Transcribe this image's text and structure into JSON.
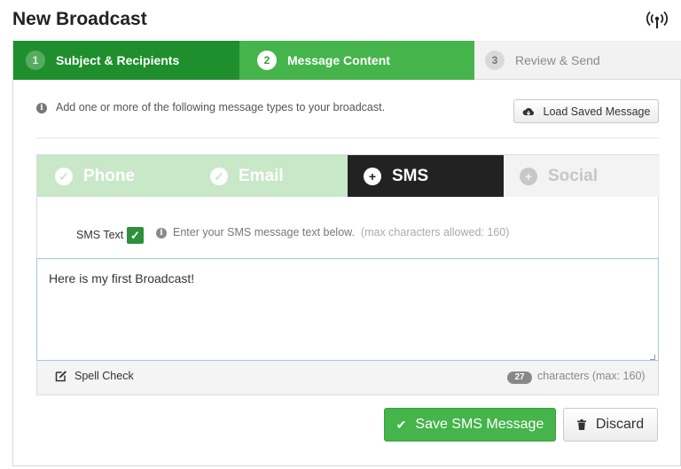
{
  "header": {
    "title": "New Broadcast",
    "icon": "broadcast-antenna-icon"
  },
  "steps": [
    {
      "number": "1",
      "label": "Subject & Recipients",
      "state": "done"
    },
    {
      "number": "2",
      "label": "Message Content",
      "state": "active"
    },
    {
      "number": "3",
      "label": "Review & Send",
      "state": "pending"
    }
  ],
  "info": {
    "text": "Add one or more of the following message types to your broadcast.",
    "load_button": "Load Saved Message"
  },
  "tabs": [
    {
      "label": "Phone",
      "icon": "check-circle-icon",
      "state": "added"
    },
    {
      "label": "Email",
      "icon": "check-circle-icon",
      "state": "added"
    },
    {
      "label": "SMS",
      "icon": "plus-circle-icon",
      "state": "selected"
    },
    {
      "label": "Social",
      "icon": "plus-circle-icon",
      "state": "inactive"
    }
  ],
  "sms": {
    "label": "SMS Text",
    "hint": "Enter your SMS message text below.",
    "hint_max": "(max characters allowed: 160)",
    "message": "Here is my first Broadcast!",
    "spell_check": "Spell Check",
    "char_count": "27",
    "char_text": "characters (max: 160)"
  },
  "actions": {
    "save": "Save SMS Message",
    "discard": "Discard"
  },
  "colors": {
    "dark_green": "#1f8f2d",
    "green": "#45b44b",
    "light_green": "#c8e8c8",
    "dark": "#222222"
  }
}
